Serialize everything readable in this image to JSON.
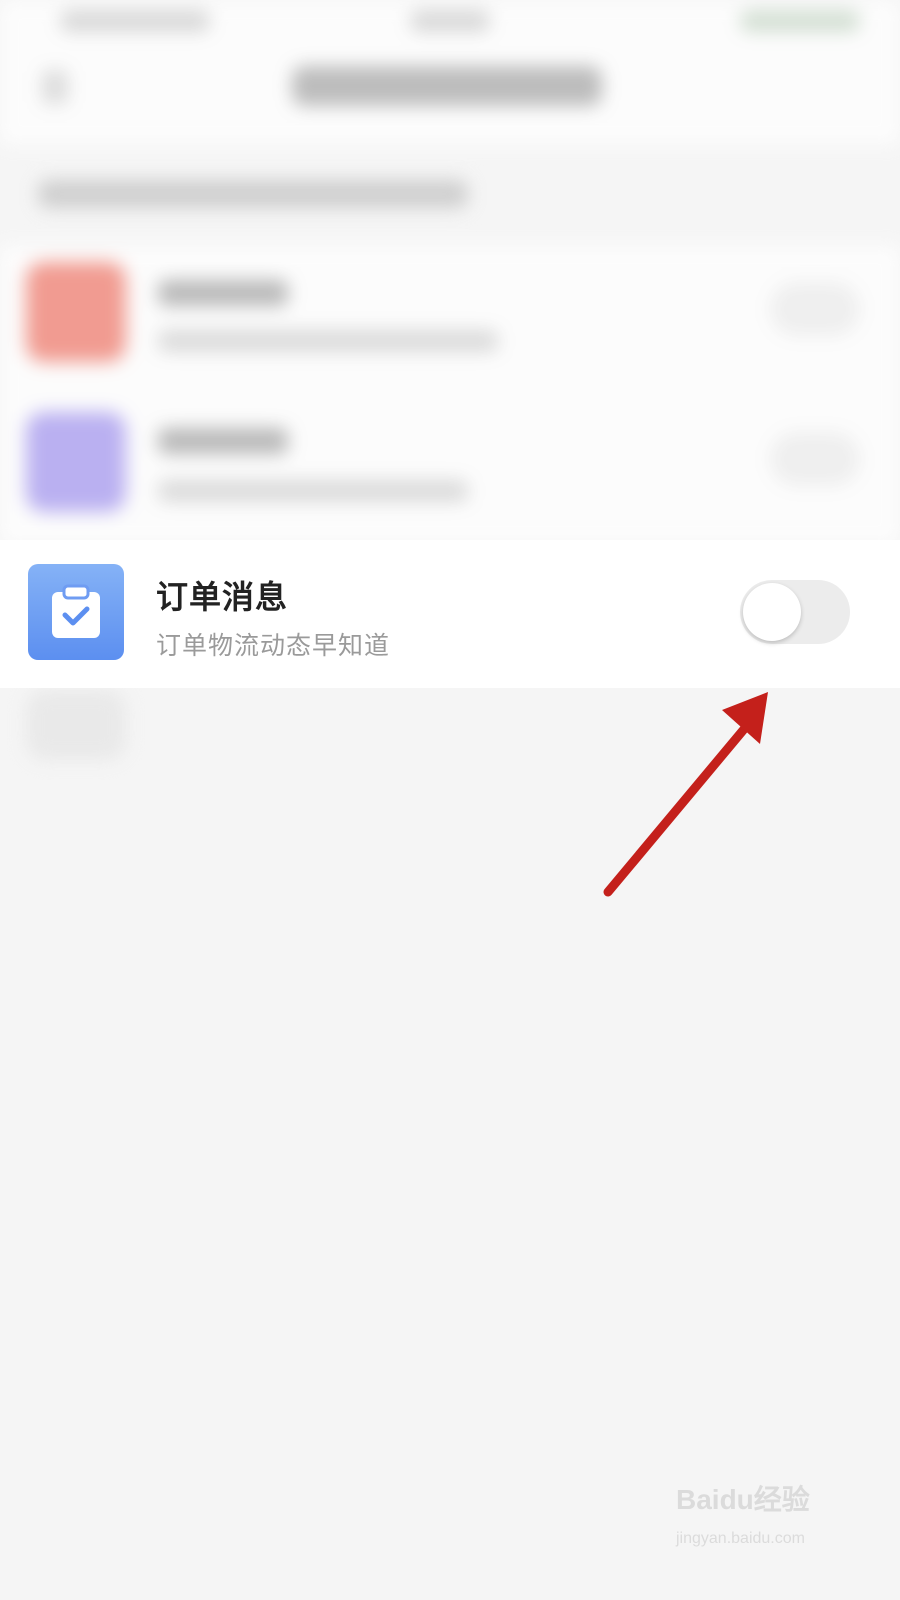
{
  "notification_row": {
    "title": "订单消息",
    "subtitle": "订单物流动态早知道",
    "icon": "clipboard-check-icon",
    "toggle_on": false
  },
  "colors": {
    "page_background": "#f5f5f5",
    "icon_gradient_top": "#85b2f6",
    "icon_gradient_bottom": "#5c8ff0",
    "toggle_off_track": "#ececec",
    "annotation_arrow": "#c4201b"
  },
  "watermark": {
    "brand": "Baidu经验",
    "url": "jingyan.baidu.com"
  }
}
